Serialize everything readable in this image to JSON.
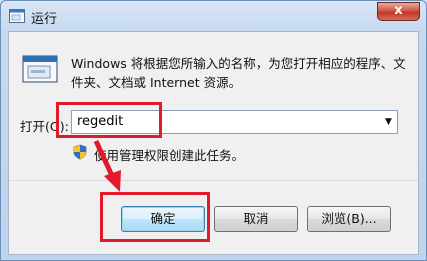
{
  "window": {
    "title": "运行",
    "close_label": "x"
  },
  "dialog": {
    "description": "Windows 将根据您所输入的名称，为您打开相应的程序、文件夹、文档或 Internet 资源。",
    "open_label": "打开(O):",
    "combo_value": "regedit",
    "admin_note": "使用管理权限创建此任务。"
  },
  "buttons": {
    "ok": "确定",
    "cancel": "取消",
    "browse": "浏览(B)..."
  },
  "icons": {
    "title": "run-icon",
    "run": "run-program-icon",
    "shield": "uac-shield-icon",
    "dropdown": "chevron-down-icon"
  },
  "colors": {
    "highlight": "#e3192c",
    "default_button_border": "#3c7fb1",
    "title_gradient": "#c6d9ef"
  }
}
